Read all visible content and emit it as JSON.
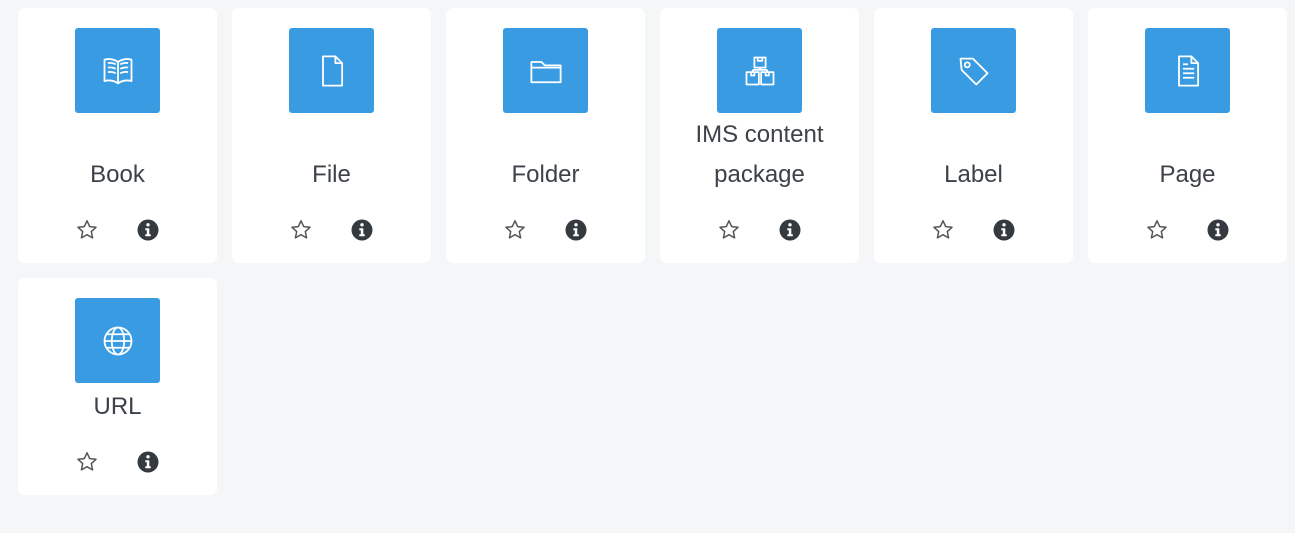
{
  "modules": [
    {
      "label": "Book",
      "icon": "book-icon"
    },
    {
      "label": "File",
      "icon": "file-icon"
    },
    {
      "label": "Folder",
      "icon": "folder-icon"
    },
    {
      "label": "IMS content package",
      "icon": "package-icon"
    },
    {
      "label": "Label",
      "icon": "tag-icon"
    },
    {
      "label": "Page",
      "icon": "page-icon"
    },
    {
      "label": "URL",
      "icon": "globe-icon"
    }
  ],
  "colors": {
    "icon_bg": "#399be2",
    "card_bg": "#ffffff",
    "page_bg": "#f5f6f8",
    "text": "#3c4248"
  }
}
